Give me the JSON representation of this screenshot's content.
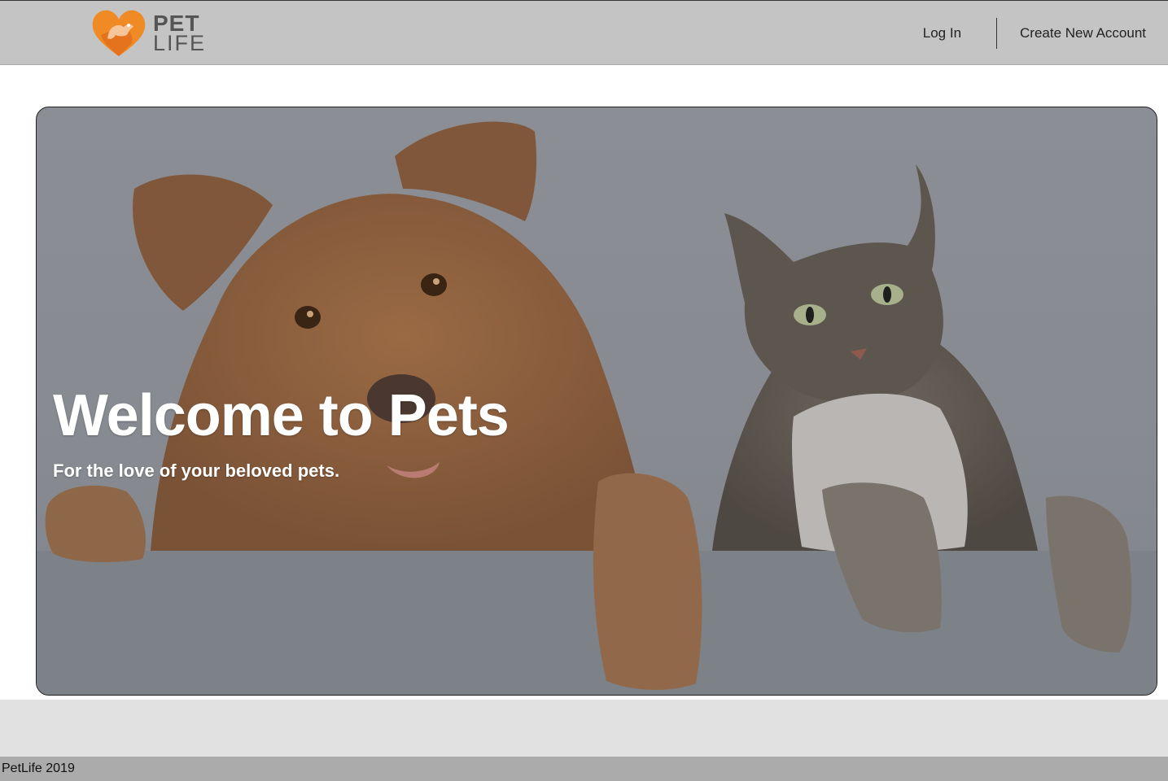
{
  "header": {
    "logo": {
      "line1": "PET",
      "line2": "LIFE",
      "icon": "heart-pet-icon",
      "brand_color": "#f08a24"
    },
    "nav": {
      "login": "Log In",
      "create_account": "Create New Account"
    }
  },
  "hero": {
    "title": "Welcome to Pets",
    "subtitle": "For the love of your beloved pets.",
    "image": "dog-and-cat-image"
  },
  "footer": {
    "text": "PetLife 2019"
  }
}
